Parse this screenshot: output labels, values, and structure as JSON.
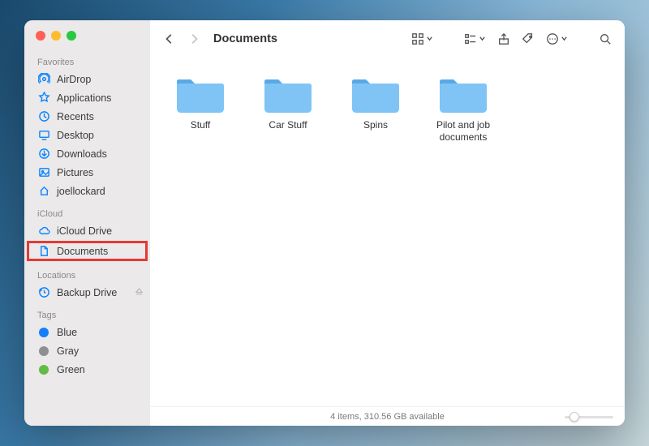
{
  "window": {
    "title": "Documents"
  },
  "sidebar": {
    "sections": [
      {
        "label": "Favorites",
        "items": [
          {
            "icon": "airdrop-icon",
            "label": "AirDrop"
          },
          {
            "icon": "applications-icon",
            "label": "Applications"
          },
          {
            "icon": "recents-icon",
            "label": "Recents"
          },
          {
            "icon": "desktop-icon",
            "label": "Desktop"
          },
          {
            "icon": "downloads-icon",
            "label": "Downloads"
          },
          {
            "icon": "pictures-icon",
            "label": "Pictures"
          },
          {
            "icon": "home-icon",
            "label": "joellockard"
          }
        ]
      },
      {
        "label": "iCloud",
        "items": [
          {
            "icon": "cloud-icon",
            "label": "iCloud Drive"
          },
          {
            "icon": "document-icon",
            "label": "Documents",
            "highlighted": true
          }
        ]
      },
      {
        "label": "Locations",
        "items": [
          {
            "icon": "timemachine-icon",
            "label": "Backup Drive",
            "eject": true
          }
        ]
      },
      {
        "label": "Tags",
        "items": [
          {
            "icon": "tag-dot",
            "label": "Blue",
            "color": "#157efb"
          },
          {
            "icon": "tag-dot",
            "label": "Gray",
            "color": "#8e8e93"
          },
          {
            "icon": "tag-dot",
            "label": "Green",
            "color": "#61bb46"
          }
        ]
      }
    ]
  },
  "folders": [
    {
      "name": "Stuff"
    },
    {
      "name": "Car Stuff"
    },
    {
      "name": "Spins"
    },
    {
      "name": "Pilot and job documents"
    }
  ],
  "status": {
    "text": "4 items, 310.56 GB available"
  }
}
